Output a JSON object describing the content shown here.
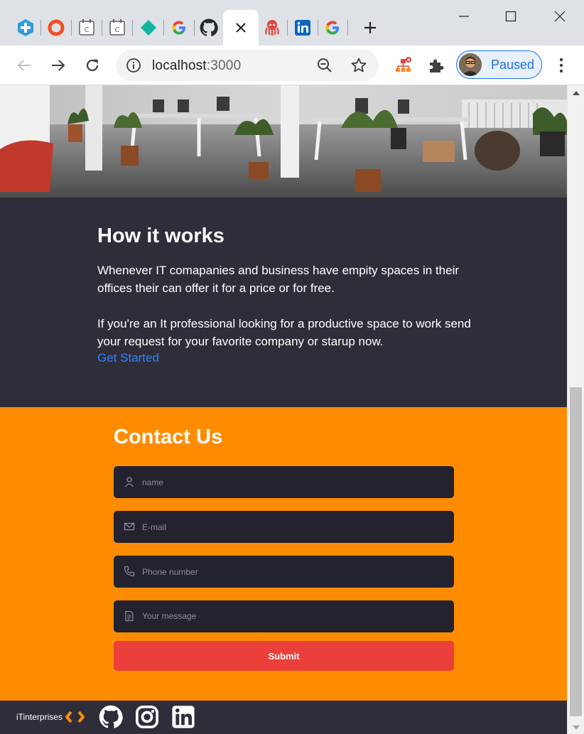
{
  "browser": {
    "tabs": [
      {
        "icon": "plus-badge-icon",
        "color": "#2d9cdb"
      },
      {
        "icon": "ring-icon",
        "color": "#f25022"
      },
      {
        "icon": "calendar-c-icon",
        "color": "#5f6368"
      },
      {
        "icon": "calendar-c-icon",
        "color": "#5f6368"
      },
      {
        "icon": "diamond-icon",
        "color": "#10b5a0"
      },
      {
        "icon": "google-icon",
        "color": "#4285f4"
      },
      {
        "icon": "github-icon",
        "color": "#24292e"
      },
      {
        "icon": "close-icon",
        "color": "#202124",
        "active": true
      },
      {
        "icon": "octopus-icon",
        "color": "#e0443c"
      },
      {
        "icon": "linkedin-icon",
        "color": "#0a66c2"
      },
      {
        "icon": "google-icon",
        "color": "#4285f4"
      }
    ],
    "url_host": "localhost",
    "url_port": ":3000",
    "profile_label": "Paused"
  },
  "how_it_works": {
    "title": "How it works",
    "paragraph_1": "Whenever IT comapanies and business have empity spaces in their offices their can offer it for a price or for free.",
    "paragraph_2": "If you're an It professional looking for a productive space to work send your request for your favorite company or starup now.",
    "cta": "Get Started"
  },
  "contact": {
    "title": "Contact Us",
    "fields": {
      "name": {
        "placeholder": "name",
        "icon": "user-icon"
      },
      "email": {
        "placeholder": "E-mail",
        "icon": "mail-icon"
      },
      "phone": {
        "placeholder": "Phone number",
        "icon": "phone-icon"
      },
      "message": {
        "placeholder": "Your message",
        "icon": "document-icon"
      }
    },
    "submit_label": "Submit"
  },
  "footer": {
    "brand": "iTinterprises",
    "social": [
      "github-icon",
      "instagram-icon",
      "linkedin-icon"
    ]
  },
  "colors": {
    "dark_section": "#302d3a",
    "contact_bg": "#ff8c00",
    "input_bg": "#24222e",
    "submit_bg": "#ea3f3a",
    "link": "#2f80ff"
  }
}
